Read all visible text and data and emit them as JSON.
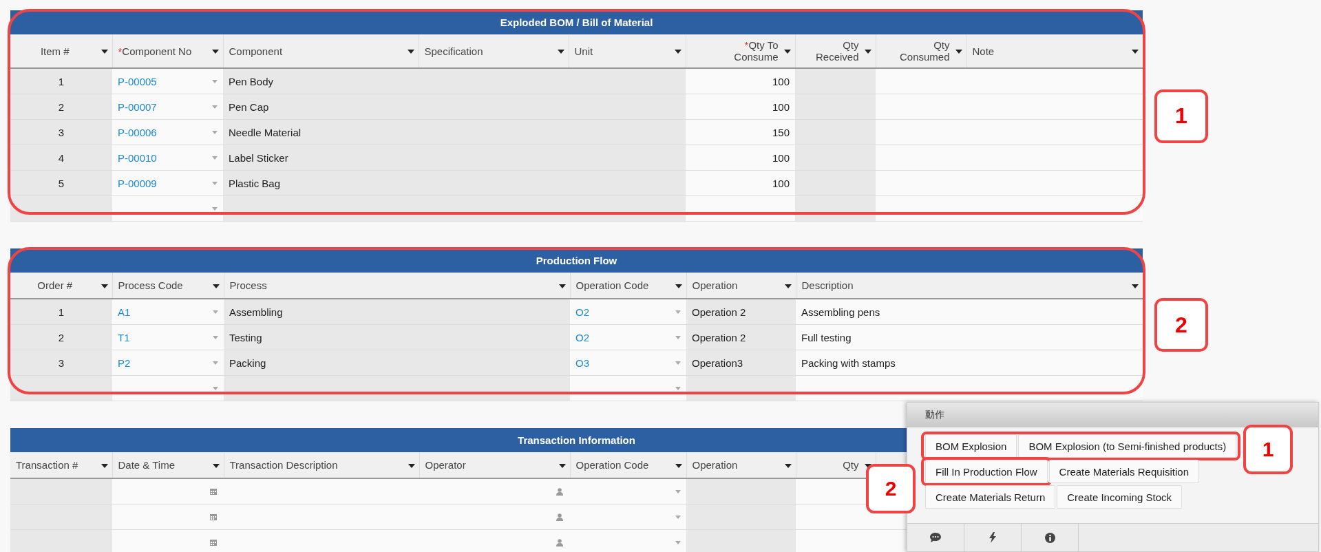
{
  "tables": [
    {
      "title": "Exploded BOM / Bill of Material",
      "callout": "1",
      "new_row": true,
      "columns": [
        {
          "label": "Item #",
          "kind": "index"
        },
        {
          "label": "Component No",
          "required_mark": "*",
          "kind": "lookup"
        },
        {
          "label": "Component",
          "kind": "readonly"
        },
        {
          "label": "Specification",
          "kind": "readonly"
        },
        {
          "label": "Unit",
          "kind": "readonly"
        },
        {
          "label": "Qty To Consume",
          "required_mark": "*",
          "kind": "number"
        },
        {
          "label": "Qty Received",
          "kind": "readonly_number"
        },
        {
          "label": "Qty Consumed",
          "kind": "number"
        },
        {
          "label": "Note",
          "kind": "text"
        }
      ],
      "rows": [
        {
          "cells": [
            "1",
            "P-00005",
            "Pen Body",
            null,
            null,
            "100",
            null,
            null,
            null
          ]
        },
        {
          "cells": [
            "2",
            "P-00007",
            "Pen Cap",
            null,
            null,
            "100",
            null,
            null,
            null
          ]
        },
        {
          "cells": [
            "3",
            "P-00006",
            "Needle Material",
            null,
            null,
            "150",
            null,
            null,
            null
          ]
        },
        {
          "cells": [
            "4",
            "P-00010",
            "Label Sticker",
            null,
            null,
            "100",
            null,
            null,
            null
          ]
        },
        {
          "cells": [
            "5",
            "P-00009",
            "Plastic Bag",
            null,
            null,
            "100",
            null,
            null,
            null
          ]
        }
      ]
    },
    {
      "title": "Production Flow",
      "callout": "2",
      "new_row": true,
      "columns": [
        {
          "label": "Order #",
          "kind": "index"
        },
        {
          "label": "Process Code",
          "kind": "lookup"
        },
        {
          "label": "Process",
          "kind": "readonly"
        },
        {
          "label": "Operation Code",
          "kind": "lookup"
        },
        {
          "label": "Operation",
          "kind": "readonly"
        },
        {
          "label": "Description",
          "kind": "text"
        }
      ],
      "rows": [
        {
          "cells": [
            "1",
            "A1",
            "Assembling",
            "O2",
            "Operation 2",
            "Assembling pens"
          ]
        },
        {
          "cells": [
            "2",
            "T1",
            "Testing",
            "O2",
            "Operation 2",
            "Full testing"
          ]
        },
        {
          "cells": [
            "3",
            "P2",
            "Packing",
            "O3",
            "Operation3",
            "Packing with stamps"
          ]
        }
      ]
    },
    {
      "title": "Transaction Information",
      "columns": [
        {
          "label": "Transaction #",
          "kind": "readonly"
        },
        {
          "label": "Date & Time",
          "kind": "date"
        },
        {
          "label": "Transaction Description",
          "kind": "text"
        },
        {
          "label": "Operator",
          "kind": "user"
        },
        {
          "label": "Operation Code",
          "kind": "lookup"
        },
        {
          "label": "Operation",
          "kind": "readonly"
        },
        {
          "label": "Qty",
          "kind": "number"
        }
      ],
      "rows": [
        {
          "cells": [
            null,
            null,
            null,
            null,
            null,
            null,
            null
          ]
        },
        {
          "cells": [
            null,
            null,
            null,
            null,
            null,
            null,
            null
          ]
        },
        {
          "cells": [
            null,
            null,
            null,
            null,
            null,
            null,
            null
          ]
        }
      ]
    }
  ],
  "actions_panel": {
    "title": "動作",
    "button_rows": [
      {
        "callout": "1",
        "buttons": [
          {
            "label": "BOM Explosion"
          },
          {
            "label": "BOM Explosion (to Semi-finished products)"
          }
        ]
      },
      {
        "buttons": [
          {
            "label": "Fill In Production Flow",
            "callout": "2"
          },
          {
            "label": "Create Materials Requisition"
          }
        ]
      },
      {
        "buttons": [
          {
            "label": "Create Materials Return"
          },
          {
            "label": "Create Incoming Stock"
          }
        ]
      }
    ],
    "footer_tabs": [
      {
        "kind": "comments"
      },
      {
        "kind": "automation"
      },
      {
        "kind": "info"
      }
    ]
  }
}
